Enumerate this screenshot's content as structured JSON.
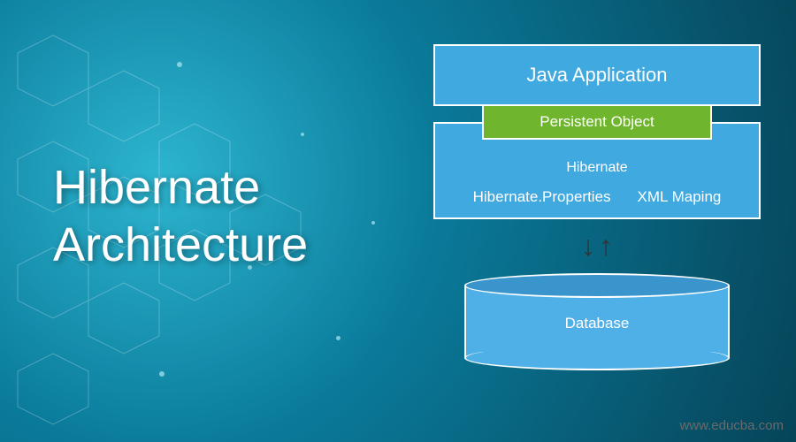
{
  "title_line1": "Hibernate",
  "title_line2": "Architecture",
  "diagram": {
    "java_app": "Java Application",
    "persistent": "Persistent Object",
    "hibernate_label": "Hibernate",
    "hibernate_props": "Hibernate.Properties",
    "xml_mapping": "XML Maping",
    "database": "Database"
  },
  "watermark": "www.educba.com",
  "colors": {
    "bg_center": "#2db5d0",
    "bg_outer": "#064458",
    "box_blue": "#3fa9e0",
    "box_green": "#6fb52e"
  },
  "chart_data": {
    "type": "diagram",
    "title": "Hibernate Architecture",
    "nodes": [
      {
        "id": "java_app",
        "label": "Java Application",
        "type": "layer",
        "color": "#3fa9e0"
      },
      {
        "id": "persistent_object",
        "label": "Persistent Object",
        "type": "bridge",
        "color": "#6fb52e"
      },
      {
        "id": "hibernate",
        "label": "Hibernate",
        "type": "layer",
        "color": "#3fa9e0",
        "children": [
          "Hibernate.Properties",
          "XML Maping"
        ]
      },
      {
        "id": "database",
        "label": "Database",
        "type": "datastore",
        "color": "#4fb0e8"
      }
    ],
    "edges": [
      {
        "from": "java_app",
        "to": "persistent_object",
        "style": "contained-overlap"
      },
      {
        "from": "persistent_object",
        "to": "hibernate",
        "style": "contained-overlap"
      },
      {
        "from": "hibernate",
        "to": "database",
        "style": "bidirectional-arrow"
      }
    ]
  }
}
